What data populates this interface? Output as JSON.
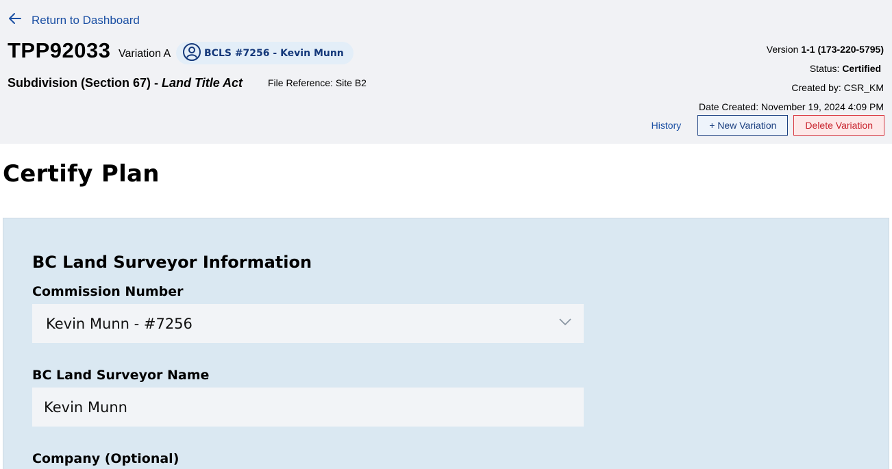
{
  "header": {
    "back_label": "Return to Dashboard",
    "plan_id": "TPP92033",
    "variation": "Variation A",
    "surveyor_chip": "BCLS #7256 - Kevin Munn",
    "plan_type": "Subdivision (Section 67) - ",
    "plan_act": "Land Title Act",
    "file_reference": "File Reference: Site B2",
    "version_label": "Version ",
    "version_value": "1-1 (173-220-5795)",
    "status_label": "Status: ",
    "status_value": "Certified",
    "created_by": "Created by: CSR_KM",
    "date_created": "Date Created: November 19, 2024 4:09 PM",
    "history_label": "History",
    "new_variation_label": "+ New Variation",
    "delete_variation_label": "Delete Variation"
  },
  "page": {
    "title": "Certify Plan"
  },
  "form": {
    "section_title": "BC Land Surveyor Information",
    "commission_label": "Commission Number",
    "commission_value": "Kevin Munn - #7256",
    "surveyor_name_label": "BC Land Surveyor Name",
    "surveyor_name_value": "Kevin Munn",
    "company_label": "Company (Optional)"
  },
  "colors": {
    "link": "#1a4fa3",
    "panel_bg": "#dae8f2",
    "header_bg": "#f1f2f5",
    "delete": "#c8202a"
  },
  "icons": {
    "back": "arrow-left-icon",
    "surveyor": "user-circle-icon",
    "select": "chevron-down-icon"
  }
}
